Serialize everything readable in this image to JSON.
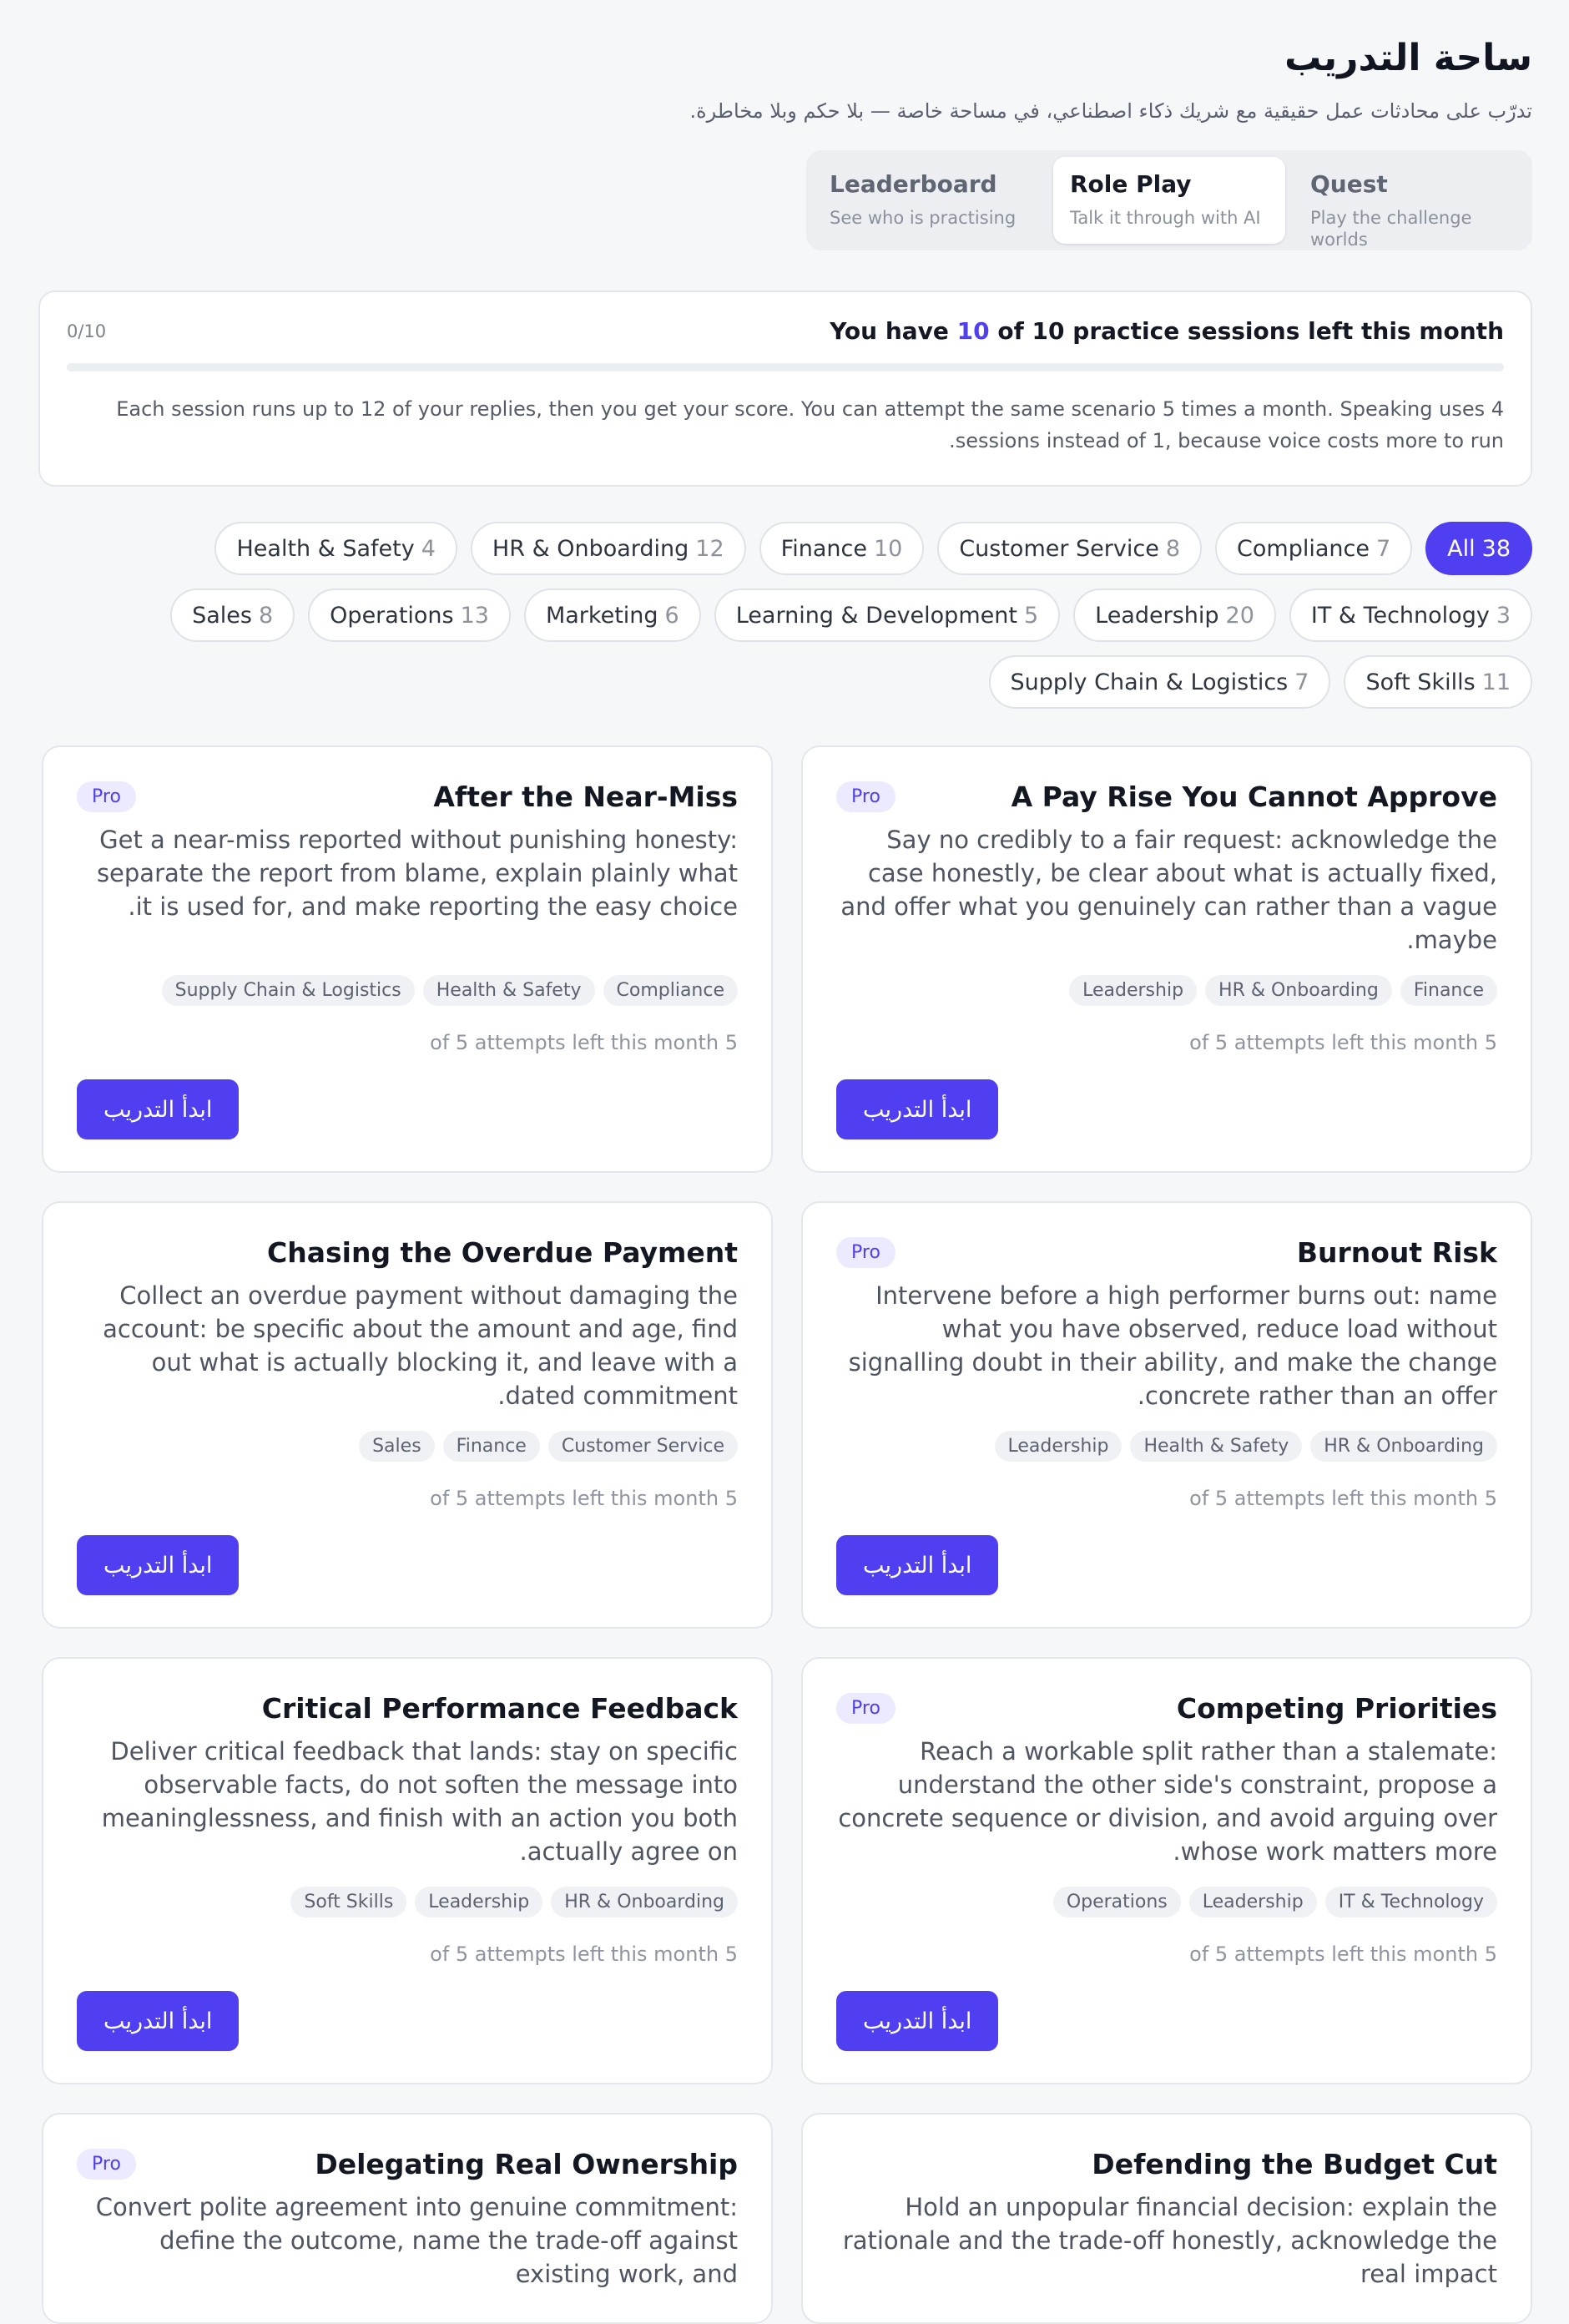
{
  "header": {
    "title": "ساحة التدريب",
    "subtitle": "تدرّب على محادثات عمل حقيقية مع شريك ذكاء اصطناعي، في مساحة خاصة — بلا حكم وبلا مخاطرة."
  },
  "mode_tabs": [
    {
      "label": "Quest",
      "sub": "Play the challenge worlds",
      "active": false
    },
    {
      "label": "Role Play",
      "sub": "Talk it through with AI",
      "active": true
    },
    {
      "label": "Leaderboard",
      "sub": "See who is practising",
      "active": false
    }
  ],
  "usage": {
    "prefix": "You have",
    "remaining": "10",
    "suffix": "of 10 practice sessions left this month",
    "count": "0/10",
    "used_fraction": 0,
    "note": "Each session runs up to 12 of your replies, then you get your score. You can attempt the same scenario 5 times a month. Speaking uses 4 sessions instead of 1, because voice costs more to run."
  },
  "filters": [
    {
      "label": "All",
      "count": "38",
      "active": true
    },
    {
      "label": "Compliance",
      "count": "7"
    },
    {
      "label": "Customer Service",
      "count": "8"
    },
    {
      "label": "Finance",
      "count": "10"
    },
    {
      "label": "HR & Onboarding",
      "count": "12"
    },
    {
      "label": "Health & Safety",
      "count": "4"
    },
    {
      "label": "IT & Technology",
      "count": "3"
    },
    {
      "label": "Leadership",
      "count": "20"
    },
    {
      "label": "Learning & Development",
      "count": "5"
    },
    {
      "label": "Marketing",
      "count": "6"
    },
    {
      "label": "Operations",
      "count": "13"
    },
    {
      "label": "Sales",
      "count": "8"
    },
    {
      "label": "Soft Skills",
      "count": "11"
    },
    {
      "label": "Supply Chain & Logistics",
      "count": "7"
    }
  ],
  "cards": [
    {
      "title": "A Pay Rise You Cannot Approve",
      "pro": "Pro",
      "desc": "Say no credibly to a fair request: acknowledge the case honestly, be clear about what is actually fixed, and offer what you genuinely can rather than a vague maybe.",
      "tags": [
        "Finance",
        "HR & Onboarding",
        "Leadership"
      ],
      "attempts": "5 of 5 attempts left this month",
      "button": "ابدأ التدريب"
    },
    {
      "title": "After the Near-Miss",
      "pro": "Pro",
      "desc": "Get a near-miss reported without punishing honesty: separate the report from blame, explain plainly what it is used for, and make reporting the easy choice.",
      "tags": [
        "Compliance",
        "Health & Safety",
        "Supply Chain & Logistics"
      ],
      "attempts": "5 of 5 attempts left this month",
      "button": "ابدأ التدريب"
    },
    {
      "title": "Burnout Risk",
      "pro": "Pro",
      "desc": "Intervene before a high performer burns out: name what you have observed, reduce load without signalling doubt in their ability, and make the change concrete rather than an offer.",
      "tags": [
        "HR & Onboarding",
        "Health & Safety",
        "Leadership"
      ],
      "attempts": "5 of 5 attempts left this month",
      "button": "ابدأ التدريب"
    },
    {
      "title": "Chasing the Overdue Payment",
      "pro": "",
      "desc": "Collect an overdue payment without damaging the account: be specific about the amount and age, find out what is actually blocking it, and leave with a dated commitment.",
      "tags": [
        "Customer Service",
        "Finance",
        "Sales"
      ],
      "attempts": "5 of 5 attempts left this month",
      "button": "ابدأ التدريب"
    },
    {
      "title": "Competing Priorities",
      "pro": "Pro",
      "desc": "Reach a workable split rather than a stalemate: understand the other side's constraint, propose a concrete sequence or division, and avoid arguing over whose work matters more.",
      "tags": [
        "IT & Technology",
        "Leadership",
        "Operations"
      ],
      "attempts": "5 of 5 attempts left this month",
      "button": "ابدأ التدريب"
    },
    {
      "title": "Critical Performance Feedback",
      "pro": "",
      "desc": "Deliver critical feedback that lands: stay on specific observable facts, do not soften the message into meaninglessness, and finish with an action you both actually agree on.",
      "tags": [
        "HR & Onboarding",
        "Leadership",
        "Soft Skills"
      ],
      "attempts": "5 of 5 attempts left this month",
      "button": "ابدأ التدريب"
    },
    {
      "title": "Defending the Budget Cut",
      "pro": "",
      "desc": "Hold an unpopular financial decision: explain the rationale and the trade-off honestly, acknowledge the real impact",
      "tags": [],
      "attempts": "",
      "button": ""
    },
    {
      "title": "Delegating Real Ownership",
      "pro": "Pro",
      "desc": "Convert polite agreement into genuine commitment: define the outcome, name the trade-off against existing work, and",
      "tags": [],
      "attempts": "",
      "button": ""
    }
  ],
  "colors": {
    "accent": "#4f3ff0",
    "page_bg": "#f6f7f9",
    "card_border": "#e3e6ea"
  }
}
